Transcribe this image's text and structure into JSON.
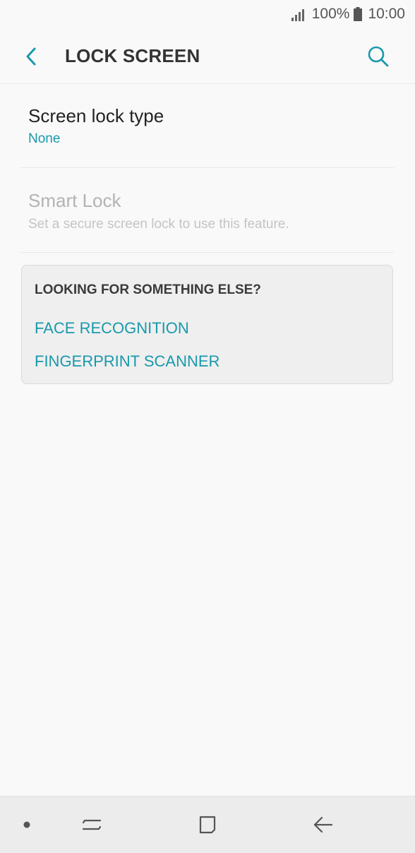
{
  "status_bar": {
    "battery_percent": "100%",
    "time": "10:00",
    "icons": [
      "signal-icon",
      "battery-icon"
    ]
  },
  "header": {
    "title": "LOCK SCREEN",
    "back_icon": "back-arrow-icon",
    "search_icon": "search-icon"
  },
  "settings": [
    {
      "label": "Screen lock type",
      "value": "None",
      "enabled": true
    },
    {
      "label": "Smart Lock",
      "value": "Set a secure screen lock to use this feature.",
      "enabled": false
    }
  ],
  "suggestions": {
    "title": "LOOKING FOR SOMETHING ELSE?",
    "links": [
      "FACE RECOGNITION",
      "FINGERPRINT SCANNER"
    ]
  },
  "nav_bar": {
    "icons": [
      "dot-icon",
      "recent-apps-icon",
      "home-icon",
      "back-icon"
    ]
  },
  "colors": {
    "accent": "#1999ac",
    "background": "#f9f9f9",
    "card_background": "#efefef"
  }
}
